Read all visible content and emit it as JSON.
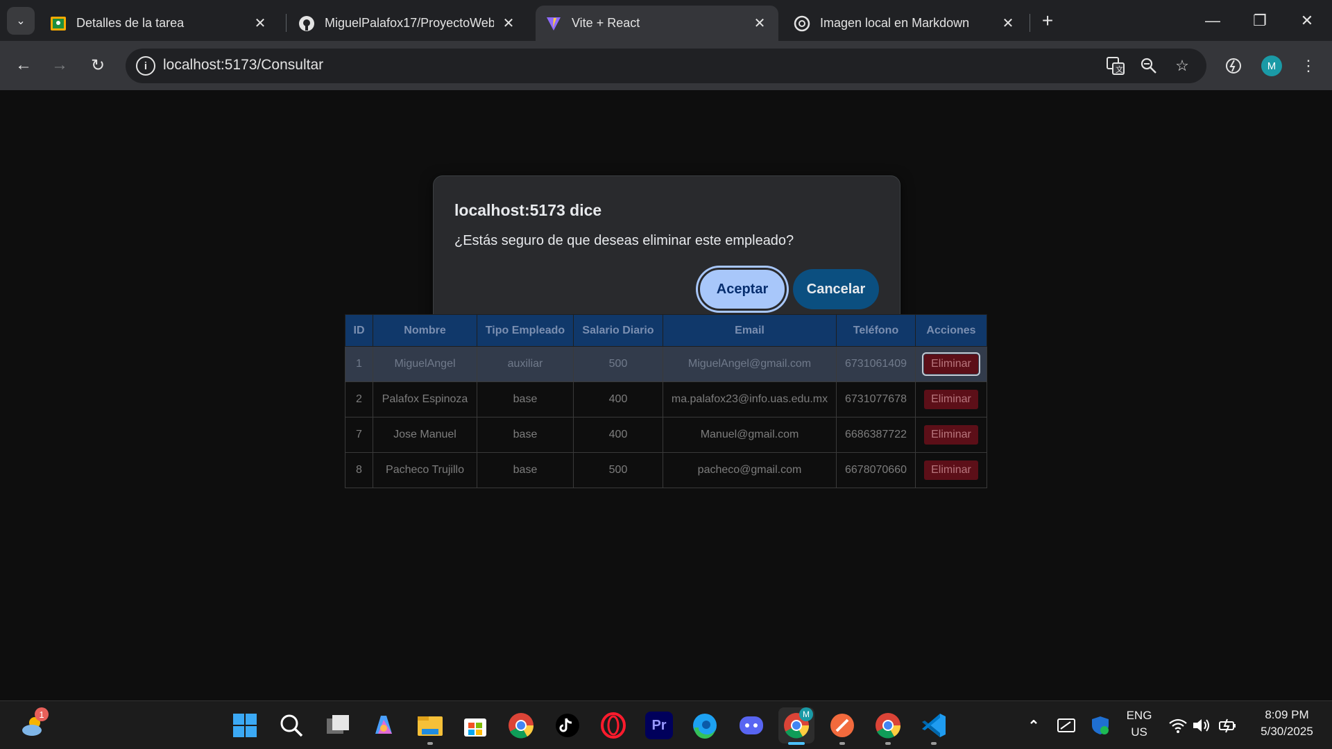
{
  "browser": {
    "tabs": [
      {
        "title": "Detalles de la tarea",
        "icon": "google-classroom-icon",
        "active": false
      },
      {
        "title": "MiguelPalafox17/ProyectoWeb",
        "icon": "github-icon",
        "active": false
      },
      {
        "title": "Vite + React",
        "icon": "vite-icon",
        "active": true
      },
      {
        "title": "Imagen local en Markdown",
        "icon": "chatgpt-icon",
        "active": false
      }
    ],
    "url": "localhost:5173/Consultar",
    "profile_initial": "M",
    "colors": {
      "tabstrip": "#202124",
      "toolbar": "#35363a"
    }
  },
  "dialog": {
    "title": "localhost:5173 dice",
    "message": "¿Estás seguro de que deseas eliminar este empleado?",
    "ok_label": "Aceptar",
    "cancel_label": "Cancelar",
    "colors": {
      "ok_bg": "#a8c7fa",
      "cancel_bg": "#0b4f80"
    }
  },
  "table": {
    "headers": [
      "ID",
      "Nombre",
      "Tipo Empleado",
      "Salario Diario",
      "Email",
      "Teléfono",
      "Acciones"
    ],
    "rows": [
      {
        "id": "1",
        "nombre": "MiguelAngel",
        "tipo": "auxiliar",
        "salario": "500",
        "email": "MiguelAngel@gmail.com",
        "telefono": "6731061409",
        "accion": "Eliminar"
      },
      {
        "id": "2",
        "nombre": "Palafox Espinoza",
        "tipo": "base",
        "salario": "400",
        "email": "ma.palafox23@info.uas.edu.mx",
        "telefono": "6731077678",
        "accion": "Eliminar"
      },
      {
        "id": "7",
        "nombre": "Jose Manuel",
        "tipo": "base",
        "salario": "400",
        "email": "Manuel@gmail.com",
        "telefono": "6686387722",
        "accion": "Eliminar"
      },
      {
        "id": "8",
        "nombre": "Pacheco Trujillo",
        "tipo": "base",
        "salario": "500",
        "email": "pacheco@gmail.com",
        "telefono": "6678070660",
        "accion": "Eliminar"
      }
    ],
    "colors": {
      "header_bg": "#10386a",
      "delete_bg": "#5c0f18"
    }
  },
  "taskbar": {
    "weather_badge": "1",
    "language": "ENG",
    "region": "US",
    "time": "8:09 PM",
    "date": "5/30/2025",
    "apps": [
      "start-icon",
      "search-icon",
      "task-view-icon",
      "copilot-icon",
      "file-explorer-icon",
      "microsoft-store-icon",
      "chrome-icon",
      "tiktok-icon",
      "opera-icon",
      "premiere-icon",
      "edge-icon",
      "discord-icon",
      "chrome-profile-icon",
      "pen-app-icon",
      "chrome-alt-icon",
      "vscode-icon"
    ],
    "apps_labels": {
      "premiere": "Pr",
      "chrome_profile_badge": "M"
    }
  }
}
